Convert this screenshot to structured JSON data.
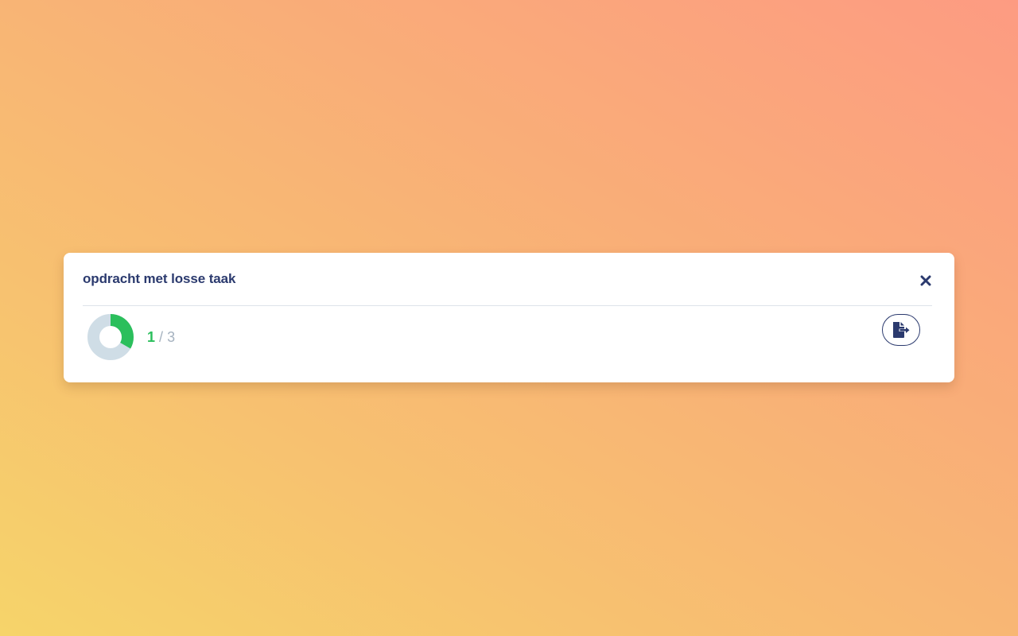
{
  "card": {
    "title": "opdracht met losse taak"
  },
  "progress": {
    "completed": "1",
    "separator": "/",
    "total": "3",
    "fraction": 0.3333
  },
  "icons": {
    "close": "close-icon",
    "submit": "file-export-icon"
  },
  "colors": {
    "title": "#2b3a6e",
    "progress_done": "#2bbf5c",
    "progress_remaining": "#cfdde6",
    "muted_text": "#a5b2bf"
  }
}
